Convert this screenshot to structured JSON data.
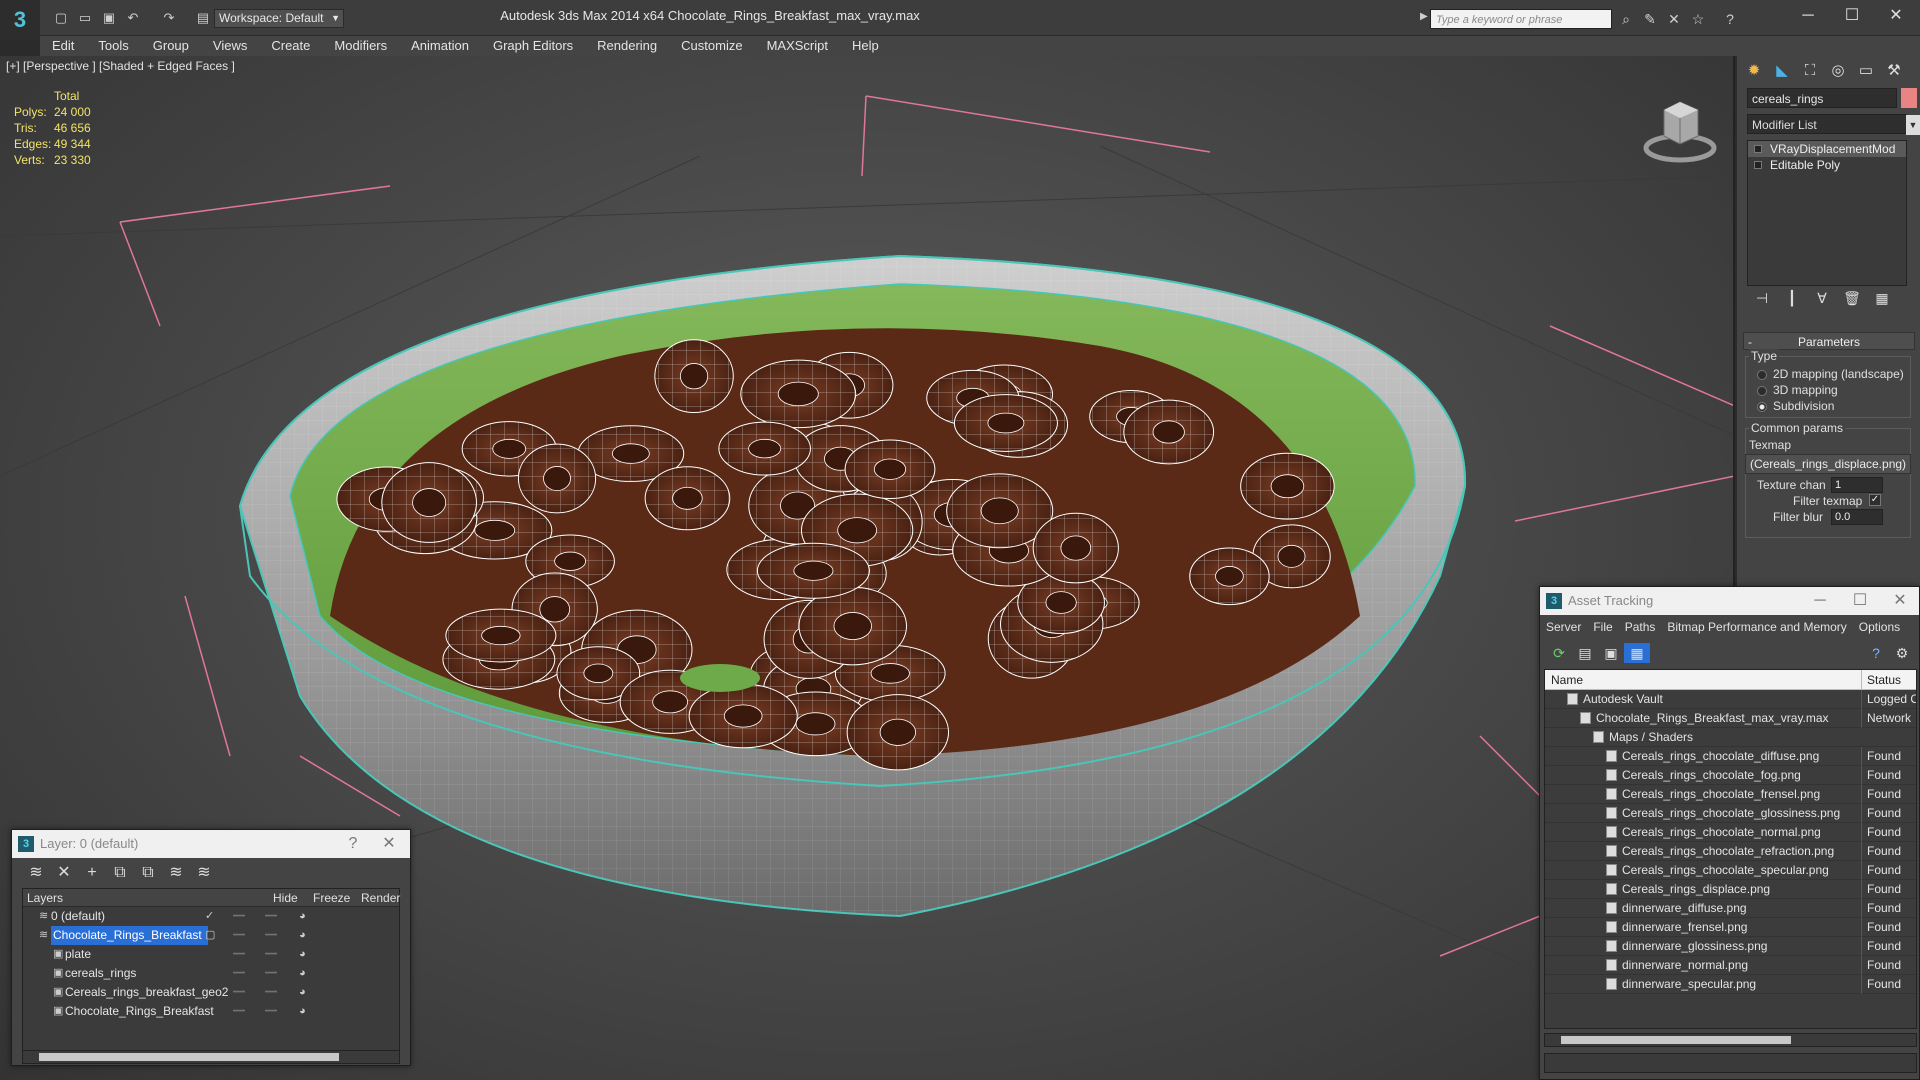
{
  "title_bar": {
    "workspace": "Workspace: Default",
    "window_title": "Autodesk 3ds Max  2014 x64      Chocolate_Rings_Breakfast_max_vray.max",
    "search_placeholder": "Type a keyword or phrase"
  },
  "menu": [
    "Edit",
    "Tools",
    "Group",
    "Views",
    "Create",
    "Modifiers",
    "Animation",
    "Graph Editors",
    "Rendering",
    "Customize",
    "MAXScript",
    "Help"
  ],
  "viewport": {
    "label": "[+] [Perspective ] [Shaded + Edged Faces ]",
    "stats": {
      "header": "Total",
      "rows": [
        {
          "key": "Polys:",
          "value": "24 000"
        },
        {
          "key": "Tris:",
          "value": "46 656"
        },
        {
          "key": "Edges:",
          "value": "49 344"
        },
        {
          "key": "Verts:",
          "value": "23 330"
        }
      ]
    }
  },
  "command_panel": {
    "object_name": "cereals_rings",
    "object_color": "#e88484",
    "modifier_list": "Modifier List",
    "stack": [
      "VRayDisplacementMod",
      "Editable Poly"
    ],
    "rollout": "Parameters",
    "type_group": "Type",
    "type_options": [
      {
        "label": "2D mapping (landscape)",
        "selected": false
      },
      {
        "label": "3D mapping",
        "selected": false
      },
      {
        "label": "Subdivision",
        "selected": true
      }
    ],
    "common_group": "Common params",
    "texmap_label": "Texmap",
    "texmap_value": "(Cereals_rings_displace.png)",
    "texture_chan_label": "Texture chan",
    "texture_chan_value": "1",
    "filter_texmap_label": "Filter texmap",
    "filter_blur_label": "Filter blur",
    "filter_blur_value": "0.0"
  },
  "layer_window": {
    "title": "Layer: 0 (default)",
    "columns": [
      "Layers",
      "Hide",
      "Freeze",
      "Render"
    ],
    "rows": [
      {
        "name": "0 (default)",
        "indent": 0,
        "selected": false
      },
      {
        "name": "Chocolate_Rings_Breakfast",
        "indent": 0,
        "selected": true
      },
      {
        "name": "plate",
        "indent": 1,
        "selected": false
      },
      {
        "name": "cereals_rings",
        "indent": 1,
        "selected": false
      },
      {
        "name": "Cereals_rings_breakfast_geo2",
        "indent": 1,
        "selected": false
      },
      {
        "name": "Chocolate_Rings_Breakfast",
        "indent": 1,
        "selected": false
      }
    ]
  },
  "asset_window": {
    "title": "Asset Tracking",
    "menu": [
      "Server",
      "File",
      "Paths",
      "Bitmap Performance and Memory",
      "Options"
    ],
    "columns": [
      "Name",
      "Status"
    ],
    "rows": [
      {
        "name": "Autodesk Vault",
        "status": "Logged O",
        "indent": 0
      },
      {
        "name": "Chocolate_Rings_Breakfast_max_vray.max",
        "status": "Network",
        "indent": 1
      },
      {
        "name": "Maps / Shaders",
        "status": "",
        "indent": 2
      },
      {
        "name": "Cereals_rings_chocolate_diffuse.png",
        "status": "Found",
        "indent": 3
      },
      {
        "name": "Cereals_rings_chocolate_fog.png",
        "status": "Found",
        "indent": 3
      },
      {
        "name": "Cereals_rings_chocolate_frensel.png",
        "status": "Found",
        "indent": 3
      },
      {
        "name": "Cereals_rings_chocolate_glossiness.png",
        "status": "Found",
        "indent": 3
      },
      {
        "name": "Cereals_rings_chocolate_normal.png",
        "status": "Found",
        "indent": 3
      },
      {
        "name": "Cereals_rings_chocolate_refraction.png",
        "status": "Found",
        "indent": 3
      },
      {
        "name": "Cereals_rings_chocolate_specular.png",
        "status": "Found",
        "indent": 3
      },
      {
        "name": "Cereals_rings_displace.png",
        "status": "Found",
        "indent": 3
      },
      {
        "name": "dinnerware_diffuse.png",
        "status": "Found",
        "indent": 3
      },
      {
        "name": "dinnerware_frensel.png",
        "status": "Found",
        "indent": 3
      },
      {
        "name": "dinnerware_glossiness.png",
        "status": "Found",
        "indent": 3
      },
      {
        "name": "dinnerware_normal.png",
        "status": "Found",
        "indent": 3
      },
      {
        "name": "dinnerware_specular.png",
        "status": "Found",
        "indent": 3
      }
    ]
  }
}
